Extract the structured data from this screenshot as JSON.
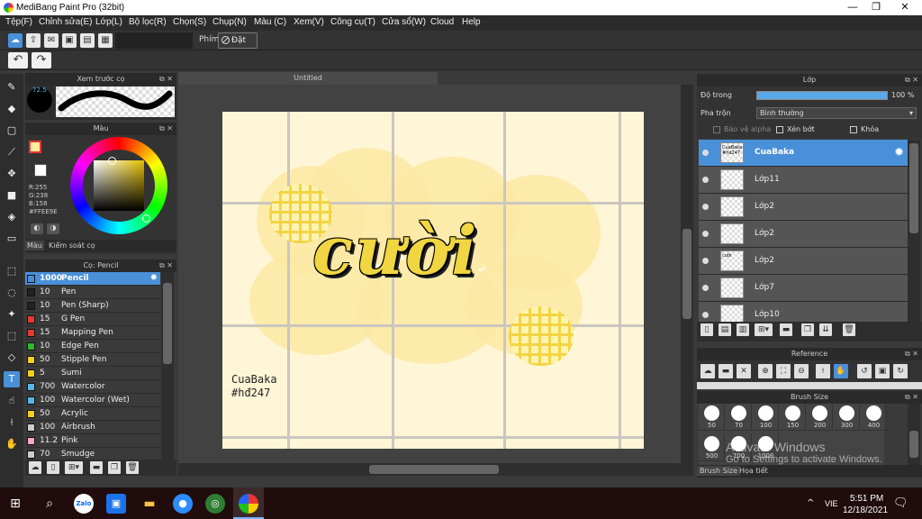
{
  "window": {
    "title": "MediBang Paint Pro (32bit)",
    "controls": [
      "—",
      "❐",
      "✕"
    ]
  },
  "menu": [
    "Tệp(F)",
    "Chỉnh sửa(E)",
    "Lớp(L)",
    "Bộ lọc(R)",
    "Chọn(S)",
    "Chụp(N)",
    "Màu (C)",
    "Xem(V)",
    "Công cụ(T)",
    "Cửa sổ(W)",
    "Cloud",
    "Help"
  ],
  "toolbar": {
    "keyboard_label": "Phím",
    "reset_label": "Đặt lại"
  },
  "brush_preview": {
    "title": "Xem trước cọ",
    "size_label": "72.5"
  },
  "color_panel": {
    "title": "Màu",
    "r": "R:255",
    "g": "G:238",
    "b": "B:158",
    "hex": "#FFEE9E",
    "fg_color": "#ffee9e",
    "tabs": [
      "Màu",
      "Kiểm soát cọ"
    ]
  },
  "brush_panel": {
    "title": "Cọ: Pencil",
    "items": [
      {
        "size": "1000",
        "name": "Pencil",
        "color": "#4a90d9"
      },
      {
        "size": "10",
        "name": "Pen",
        "color": "#222222"
      },
      {
        "size": "10",
        "name": "Pen (Sharp)",
        "color": "#222222"
      },
      {
        "size": "15",
        "name": "G Pen",
        "color": "#e53935"
      },
      {
        "size": "15",
        "name": "Mapping Pen",
        "color": "#e53935"
      },
      {
        "size": "10",
        "name": "Edge Pen",
        "color": "#2eb82e"
      },
      {
        "size": "50",
        "name": "Stipple Pen",
        "color": "#f0d020"
      },
      {
        "size": "5",
        "name": "Sumi",
        "color": "#f0d020"
      },
      {
        "size": "700",
        "name": "Watercolor",
        "color": "#5ab4e8"
      },
      {
        "size": "100",
        "name": "Watercolor (Wet)",
        "color": "#5ab4e8"
      },
      {
        "size": "50",
        "name": "Acrylic",
        "color": "#f0d020"
      },
      {
        "size": "100",
        "name": "Airbrush",
        "color": "#cccccc"
      },
      {
        "size": "11.2",
        "name": "Pink",
        "color": "#f4a6c8"
      },
      {
        "size": "70",
        "name": "Smudge",
        "color": "#cccccc"
      }
    ]
  },
  "document": {
    "tab": "Untitled",
    "artwork": {
      "word": "cười",
      "signature_line1": "CuaBaka",
      "signature_line2": "#hđ247"
    }
  },
  "layer_panel": {
    "title": "Lớp",
    "opacity_label": "Độ trong",
    "opacity_value": "100 %",
    "blend_label": "Pha trộn",
    "blend_value": "Bình thường",
    "protect_alpha": "Bảo vệ alpha",
    "clipping": "Xén bớt",
    "lock": "Khóa",
    "layers": [
      {
        "name": "CuaBaka",
        "thumb_text": "CuaBaka #hd247"
      },
      {
        "name": "Lớp11",
        "thumb_text": ""
      },
      {
        "name": "Lớp2",
        "thumb_text": ""
      },
      {
        "name": "Lớp2",
        "thumb_text": ""
      },
      {
        "name": "Lớp2",
        "thumb_text": "cười"
      },
      {
        "name": "Lớp7",
        "thumb_text": ""
      },
      {
        "name": "Lớp10",
        "thumb_text": ""
      }
    ]
  },
  "reference_panel": {
    "title": "Reference"
  },
  "brush_size_panel": {
    "title": "Brush Size",
    "sizes": [
      "50",
      "70",
      "100",
      "150",
      "200",
      "300",
      "400",
      "500",
      "700",
      "1000"
    ],
    "tabs": [
      "Brush Size",
      "Họa tiết"
    ]
  },
  "activation": {
    "line1": "Activate Windows",
    "line2": "Go to Settings to activate Windows."
  },
  "taskbar": {
    "lang": "VIE",
    "time": "5:51 PM",
    "date": "12/18/2021",
    "zalo": "Zalo"
  }
}
